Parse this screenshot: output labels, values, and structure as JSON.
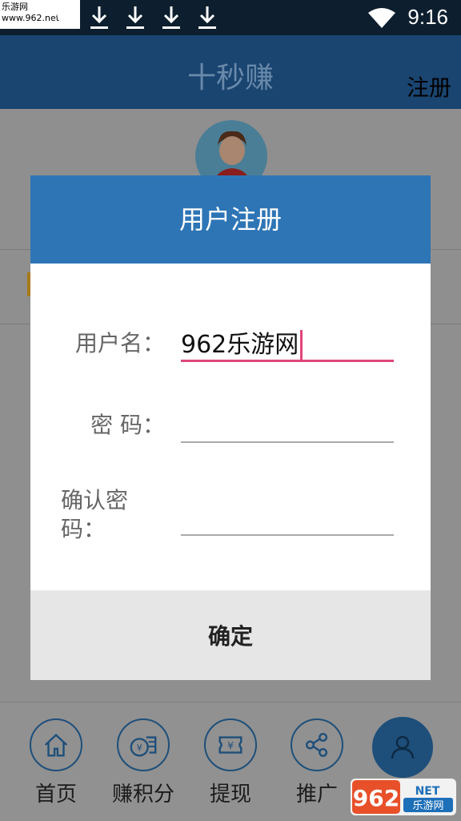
{
  "status_bar": {
    "watermark": "乐游网 www.962.net",
    "time": "9:16",
    "icons": [
      "download-icon",
      "download-icon",
      "download-icon",
      "download-icon",
      "download-icon",
      "wifi-icon"
    ]
  },
  "app_bar": {
    "title": "十秒赚",
    "register": "注册"
  },
  "dialog": {
    "title": "用户注册",
    "fields": [
      {
        "label": "用户名：",
        "value": "962乐游网"
      },
      {
        "label": "密 码：",
        "value": ""
      },
      {
        "label": "确认密码：",
        "value": ""
      }
    ],
    "confirm": "确定"
  },
  "bottom_nav": {
    "items": [
      {
        "label": "首页",
        "icon": "home-icon"
      },
      {
        "label": "赚积分",
        "icon": "coins-icon"
      },
      {
        "label": "提现",
        "icon": "ticket-icon"
      },
      {
        "label": "推广",
        "icon": "share-icon"
      },
      {
        "label": "",
        "icon": "user-icon"
      }
    ]
  },
  "logo": {
    "text_top": "962NET",
    "text_bottom": "乐游网"
  },
  "colors": {
    "dialog_header": "#2e75b6",
    "focus_underline": "#e0457b",
    "nav_accent": "#1e4f7a"
  }
}
